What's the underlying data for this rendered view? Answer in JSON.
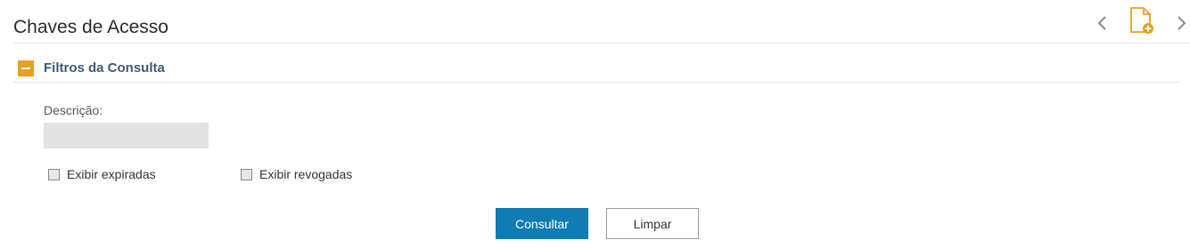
{
  "header": {
    "title": "Chaves de Acesso",
    "nav_prev_icon": "chevron-left-icon",
    "new_doc_icon": "new-document-icon",
    "nav_next_icon": "chevron-right-icon"
  },
  "filters": {
    "section_title": "Filtros da Consulta",
    "toggle_icon": "collapse-minus-icon",
    "description_label": "Descrição:",
    "description_value": "",
    "checkboxes": [
      {
        "label": "Exibir expiradas",
        "checked": false
      },
      {
        "label": "Exibir revogadas",
        "checked": false
      }
    ]
  },
  "actions": {
    "consult_label": "Consultar",
    "clear_label": "Limpar"
  },
  "colors": {
    "accent_orange": "#e8a020",
    "primary_blue": "#0f7cb3",
    "section_title": "#3d5a7a"
  }
}
